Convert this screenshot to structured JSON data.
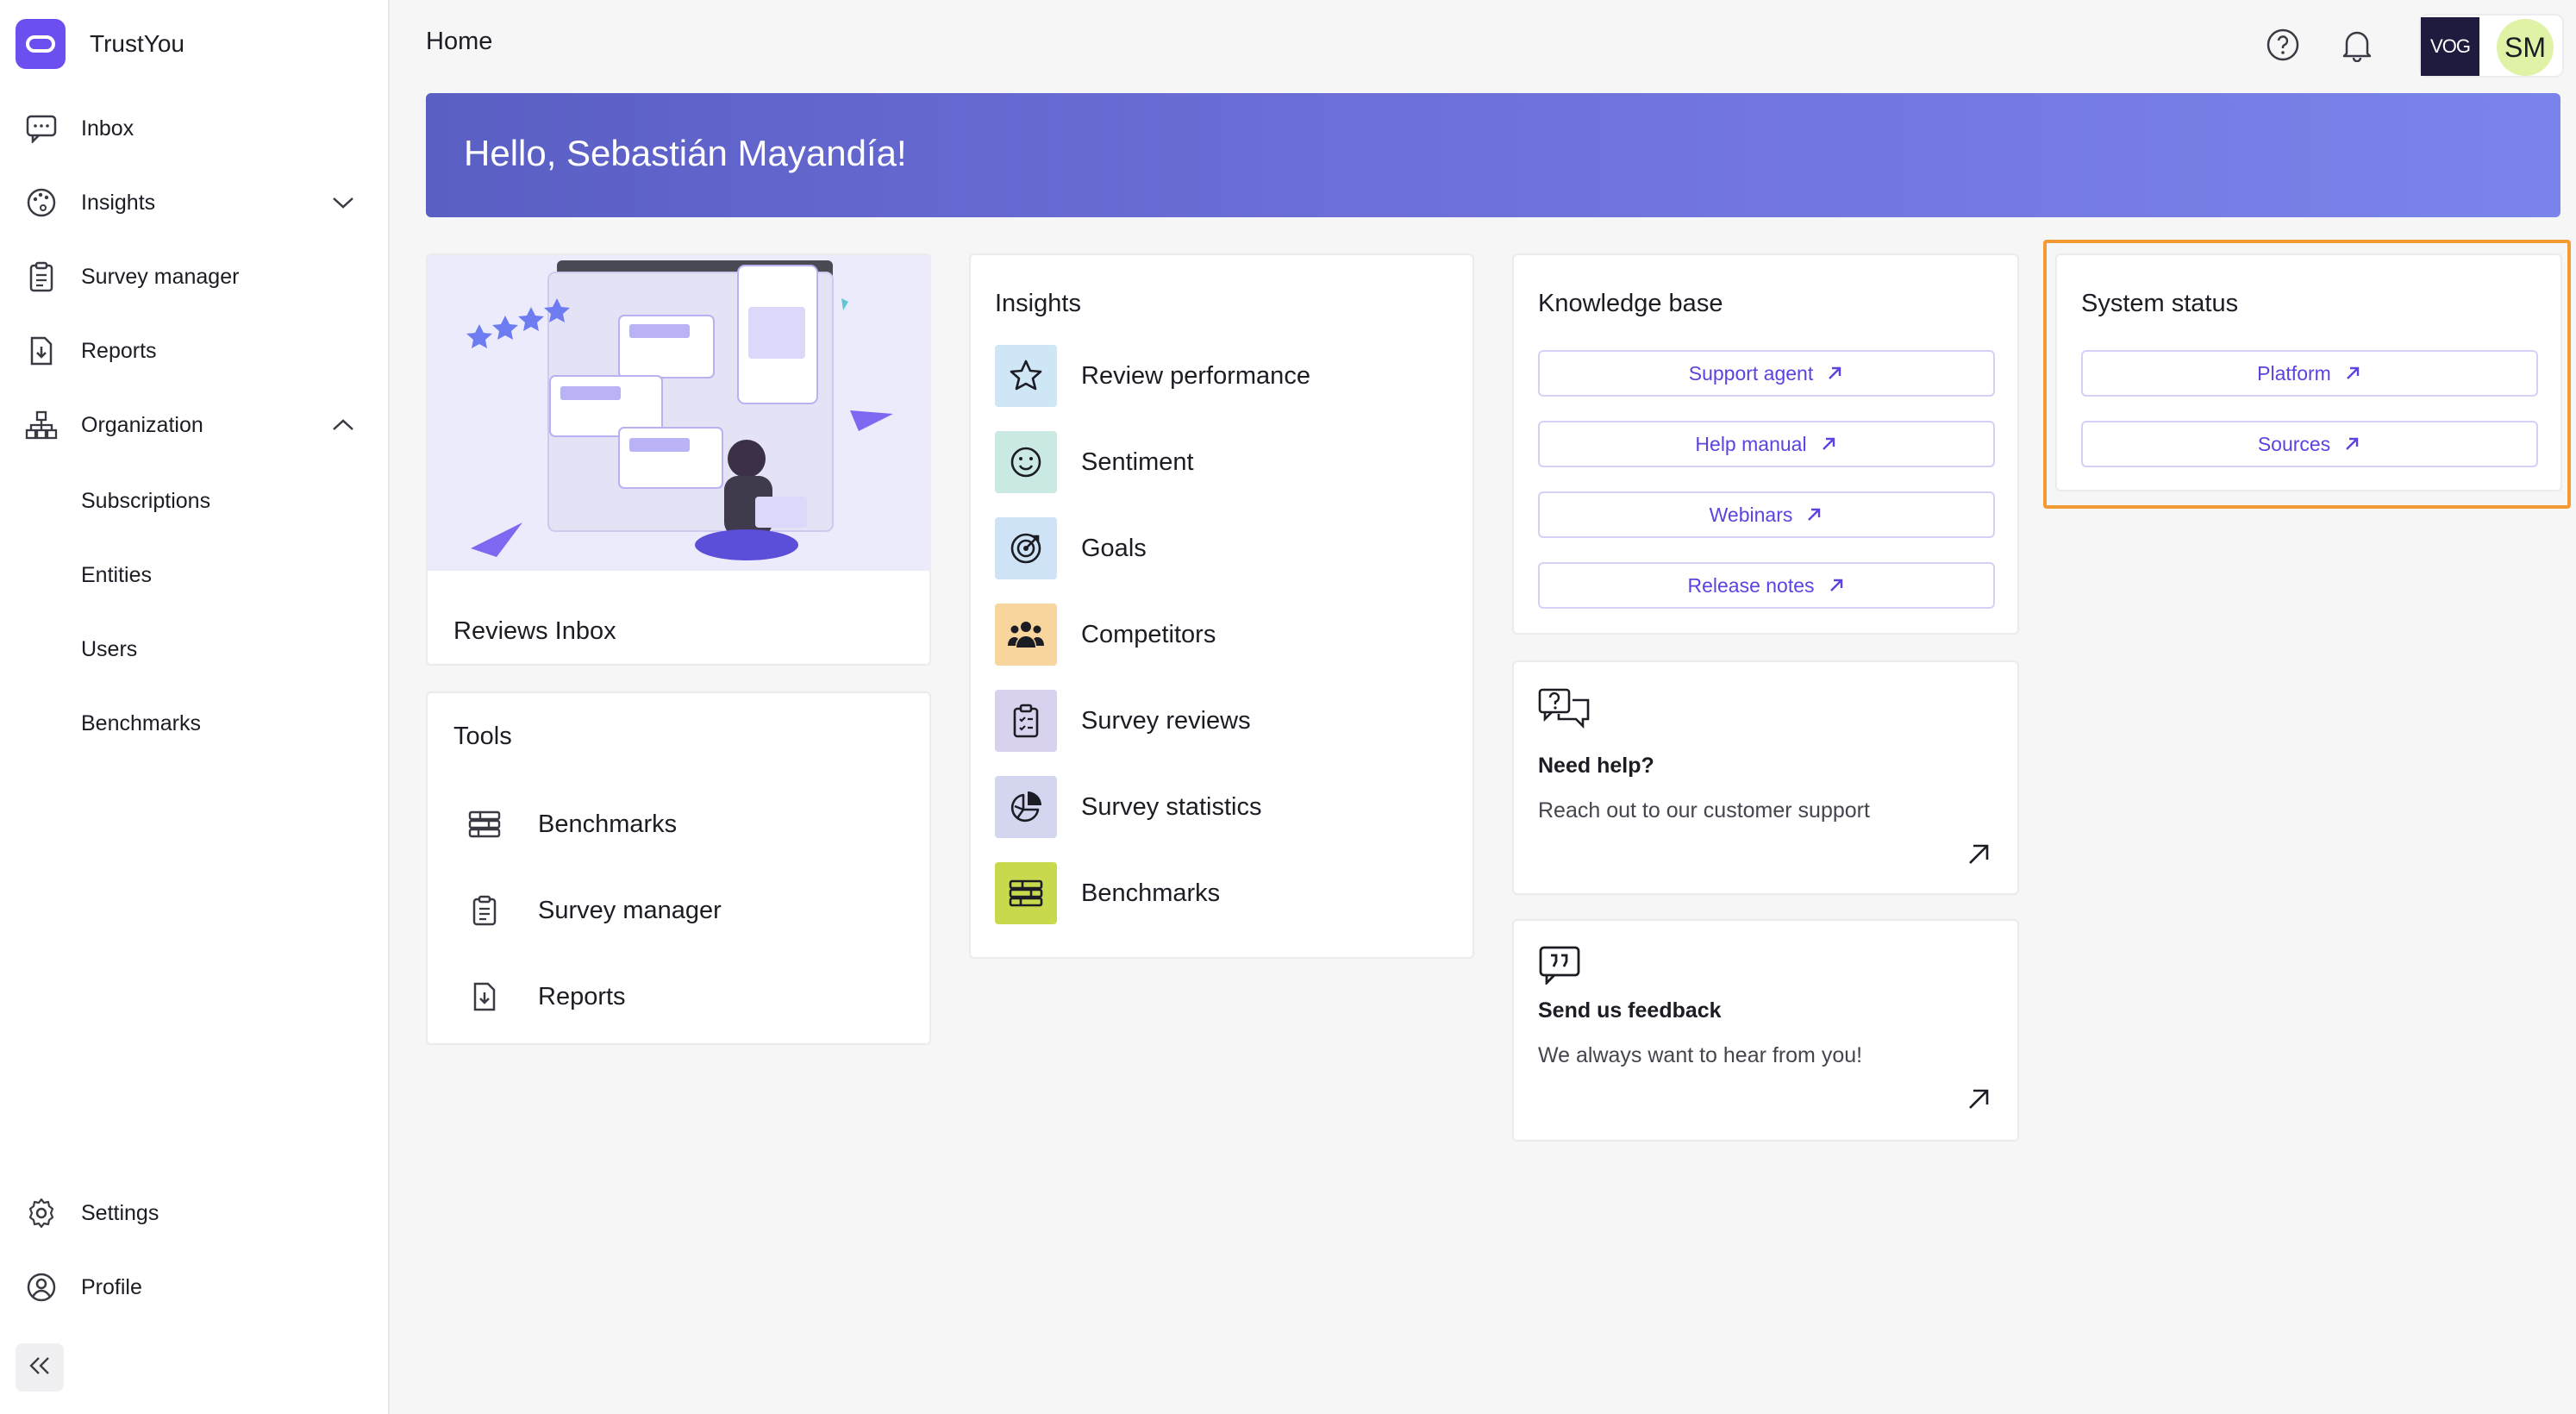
{
  "app": {
    "name": "TrustYou"
  },
  "sidebar": {
    "items": [
      {
        "label": "Inbox",
        "icon": "chat-bubble-icon"
      },
      {
        "label": "Insights",
        "icon": "palette-icon"
      },
      {
        "label": "Survey manager",
        "icon": "clipboard-icon"
      },
      {
        "label": "Reports",
        "icon": "download-doc-icon"
      },
      {
        "label": "Organization",
        "icon": "org-tree-icon"
      }
    ],
    "sub_items": [
      "Subscriptions",
      "Entities",
      "Users",
      "Benchmarks"
    ],
    "bottom": [
      {
        "label": "Settings",
        "icon": "gear-icon"
      },
      {
        "label": "Profile",
        "icon": "user-circle-icon"
      }
    ]
  },
  "header": {
    "title": "Home",
    "org_logo_text": "VOG",
    "avatar_initials": "SM"
  },
  "hero": {
    "greeting": "Hello, Sebastián Mayandía!"
  },
  "reviews_card": {
    "title": "Reviews Inbox"
  },
  "tools": {
    "title": "Tools",
    "items": [
      "Benchmarks",
      "Survey manager",
      "Reports"
    ]
  },
  "insights": {
    "title": "Insights",
    "items": [
      {
        "label": "Review performance",
        "color": "#cfe6f6"
      },
      {
        "label": "Sentiment",
        "color": "#c9e9e2"
      },
      {
        "label": "Goals",
        "color": "#cfe3f6"
      },
      {
        "label": "Competitors",
        "color": "#f8d59c"
      },
      {
        "label": "Survey reviews",
        "color": "#d8d2ef"
      },
      {
        "label": "Survey statistics",
        "color": "#d3d6ee"
      },
      {
        "label": "Benchmarks",
        "color": "#c9d94e"
      }
    ]
  },
  "knowledge_base": {
    "title": "Knowledge base",
    "links": [
      "Support agent",
      "Help manual",
      "Webinars",
      "Release notes"
    ]
  },
  "help_card": {
    "title": "Need help?",
    "text": "Reach out to our customer support"
  },
  "feedback_card": {
    "title": "Send us feedback",
    "text": "We always want to hear from you!"
  },
  "system_status": {
    "title": "System status",
    "links": [
      "Platform",
      "Sources"
    ]
  },
  "colors": {
    "accent": "#6d4ff0",
    "link": "#5b43e0",
    "highlight": "#f29a34"
  }
}
